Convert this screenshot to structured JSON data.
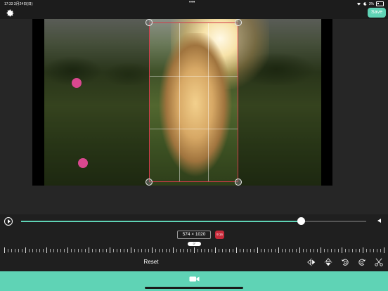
{
  "status_bar": {
    "time": "17:33",
    "date": "3月24日(日)",
    "dots": "•••",
    "battery": "3%"
  },
  "toolbar": {
    "settings_icon": "gear-icon",
    "save_label": "Save",
    "accent_color": "#5fd3b5"
  },
  "editor": {
    "crop_ratio_badge": "9:16",
    "dimension_label": "574 × 1020",
    "ruler_value": "0°",
    "crop_color": "#d23a4a",
    "marker_color": "#d9488f"
  },
  "timeline": {
    "play_icon": "play-icon",
    "progress": 0.81,
    "collapse_icon": "chevron-left-icon"
  },
  "actions": {
    "reset_label": "Reset",
    "tools": [
      "flip-horizontal-icon",
      "flip-vertical-icon",
      "rotate-left-icon",
      "rotate-right-icon",
      "scissors-icon"
    ]
  },
  "bottom_bar": {
    "tab_icon": "video-camera-icon"
  }
}
